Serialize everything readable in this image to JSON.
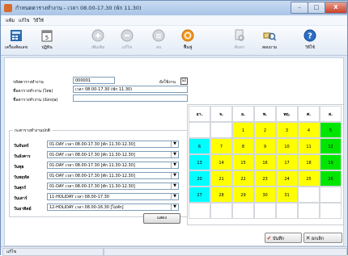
{
  "window": {
    "title": "กำหนดตารางทำงาน - เวลา 08.00-17.30 (พัก 11.30)",
    "controls": {
      "minimize": "–",
      "maximize": "□",
      "close": "X"
    }
  },
  "menu": [
    {
      "label": "แฟ้ม"
    },
    {
      "label": "แก้ไข"
    },
    {
      "label": "วิธีใช้"
    }
  ],
  "toolbar": [
    {
      "label": "เครื่องคิดเลข",
      "icon": "calculator-icon",
      "enabled": true
    },
    {
      "label": "ปฏิทิน",
      "icon": "calendar-icon",
      "enabled": true
    },
    {
      "label": "เพิ่มเติม",
      "icon": "add-circle-icon",
      "enabled": false
    },
    {
      "label": "แก้ไข",
      "icon": "edit-circle-icon",
      "enabled": false
    },
    {
      "label": "ลบ",
      "icon": "delete-circle-icon",
      "enabled": false
    },
    {
      "label": "ฟื้นฟู",
      "icon": "refresh-icon",
      "enabled": true
    },
    {
      "label": "ค้นหา",
      "icon": "find-icon",
      "enabled": false
    },
    {
      "label": "สอบถาม",
      "icon": "query-icon",
      "enabled": true
    },
    {
      "label": "วิธีใช้",
      "icon": "help-icon",
      "enabled": true
    }
  ],
  "form": {
    "code_label": "รหัสตารางทำงาน",
    "code_value": "000001",
    "use_label": "ยังใช้งาน",
    "use_checked": "☑",
    "name_th_label": "ชื่อตารางทำงาน (ไทย)",
    "name_th_value": "เวลา 08.00-17.30 (พัก 11.30)",
    "name_en_label": "ชื่อตารางทำงาน (อังกฤษ)",
    "name_en_value": ""
  },
  "schedule": {
    "group_title": "กะตารางทำงานปกติ",
    "days": [
      {
        "label": "วันจันทร์",
        "value": "01-DAY เวลา 08.00-17.30 [พัก 11.30-12.30]"
      },
      {
        "label": "วันอังคาร",
        "value": "01-DAY เวลา 08.00-17.30 [พัก 11.30-12.30]"
      },
      {
        "label": "วันพุธ",
        "value": "01-DAY เวลา 08.00-17.30 [พัก 11.30-12.30]"
      },
      {
        "label": "วันพฤหัส",
        "value": "01-DAY เวลา 08.00-17.30 [พัก 11.30-12.30]"
      },
      {
        "label": "วันศุกร์",
        "value": "01-DAY เวลา 08.00-17.30 [พัก 11.30-12.30]"
      },
      {
        "label": "วันเสาร์",
        "value": "11-HOLIDAY เวลา 08.00-17.30"
      },
      {
        "label": "วันอาทิตย์",
        "value": "12-HOLIDAY เวลา 08.00-16.30 [ไม่พัก]"
      }
    ],
    "show_button": "แสดง",
    "arrow": "▼"
  },
  "calendar": {
    "headers": [
      "อา.",
      "จ.",
      "อ.",
      "พ.",
      "พฤ.",
      "ศ.",
      "ส."
    ],
    "weeks": [
      [
        {
          "d": "",
          "c": ""
        },
        {
          "d": "",
          "c": ""
        },
        {
          "d": "1",
          "c": "yel"
        },
        {
          "d": "2",
          "c": "yel"
        },
        {
          "d": "3",
          "c": "yel"
        },
        {
          "d": "4",
          "c": "yel"
        },
        {
          "d": "5",
          "c": "gr"
        }
      ],
      [
        {
          "d": "6",
          "c": "cy"
        },
        {
          "d": "7",
          "c": "yel"
        },
        {
          "d": "8",
          "c": "yel"
        },
        {
          "d": "9",
          "c": "yel"
        },
        {
          "d": "10",
          "c": "yel"
        },
        {
          "d": "11",
          "c": "yel"
        },
        {
          "d": "12",
          "c": "gr"
        }
      ],
      [
        {
          "d": "13",
          "c": "cy"
        },
        {
          "d": "14",
          "c": "yel"
        },
        {
          "d": "15",
          "c": "yel"
        },
        {
          "d": "16",
          "c": "yel"
        },
        {
          "d": "17",
          "c": "yel"
        },
        {
          "d": "18",
          "c": "yel"
        },
        {
          "d": "19",
          "c": "gr"
        }
      ],
      [
        {
          "d": "20",
          "c": "cy"
        },
        {
          "d": "21",
          "c": "yel"
        },
        {
          "d": "22",
          "c": "yel"
        },
        {
          "d": "23",
          "c": "yel"
        },
        {
          "d": "24",
          "c": "yel"
        },
        {
          "d": "25",
          "c": "yel"
        },
        {
          "d": "26",
          "c": "gr"
        }
      ],
      [
        {
          "d": "27",
          "c": "cy"
        },
        {
          "d": "28",
          "c": "yel"
        },
        {
          "d": "29",
          "c": "yel"
        },
        {
          "d": "30",
          "c": "yel"
        },
        {
          "d": "31",
          "c": "yel"
        },
        {
          "d": "",
          "c": ""
        },
        {
          "d": "",
          "c": ""
        }
      ],
      [
        {
          "d": "",
          "c": ""
        },
        {
          "d": "",
          "c": ""
        },
        {
          "d": "",
          "c": ""
        },
        {
          "d": "",
          "c": ""
        },
        {
          "d": "",
          "c": ""
        },
        {
          "d": "",
          "c": ""
        },
        {
          "d": "",
          "c": ""
        }
      ]
    ]
  },
  "actions": {
    "save_label": "บันทึก",
    "save_icon": "✔",
    "cancel_label": "ยกเลิก",
    "cancel_icon": "✕"
  },
  "status": {
    "mode": "แก้ไข"
  },
  "colors": {
    "weekday": "#ffff00",
    "sunday": "#00ffff",
    "saturday": "#00e600"
  }
}
